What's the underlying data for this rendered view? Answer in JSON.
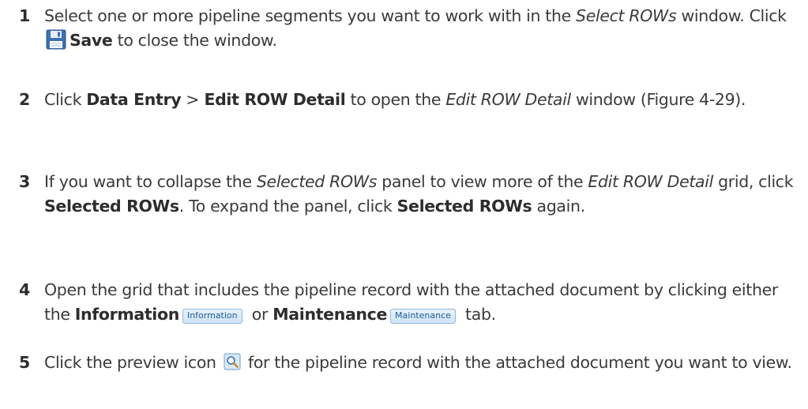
{
  "steps": [
    {
      "number": "1",
      "t1": "Select one or more pipeline segments you want to work with in the ",
      "t2": "Select ROWs",
      "t3": " window. Click ",
      "t4": "Save",
      "t5": " to close the window.",
      "icon": "save-icon"
    },
    {
      "number": "2",
      "t1": "Click ",
      "t2": "Data Entry",
      "t3": " > ",
      "t4": "Edit ROW Detail",
      "t5": " to open the ",
      "t6": "Edit ROW Detail",
      "t7": " window (Figure 4-29)."
    },
    {
      "number": "3",
      "t1": "If you want to collapse the ",
      "t2": "Selected ROWs",
      "t3": " panel to view more of the ",
      "t4": "Edit ROW Detail",
      "t5": " grid, click ",
      "t6": "Selected ROWs",
      "t7": ". To expand the panel, click ",
      "t8": "Selected ROWs",
      "t9": " again."
    },
    {
      "number": "4",
      "t1": "Open the grid that includes the pipeline record with the attached document by clicking either the ",
      "t2": "Information",
      "t3": "Information",
      "t4": " or ",
      "t5": "Maintenance",
      "t6": "Maintenance",
      "t7": " tab."
    },
    {
      "number": "5",
      "t1": "Click the preview icon ",
      "t2": " for the pipeline record with the attached document you want to view.",
      "icon": "preview-icon"
    }
  ],
  "colors": {
    "text": "#3a3a3a",
    "tab_border": "#8fb8dc",
    "tab_text": "#1f5d99",
    "save_icon": "#3d6fb3"
  }
}
